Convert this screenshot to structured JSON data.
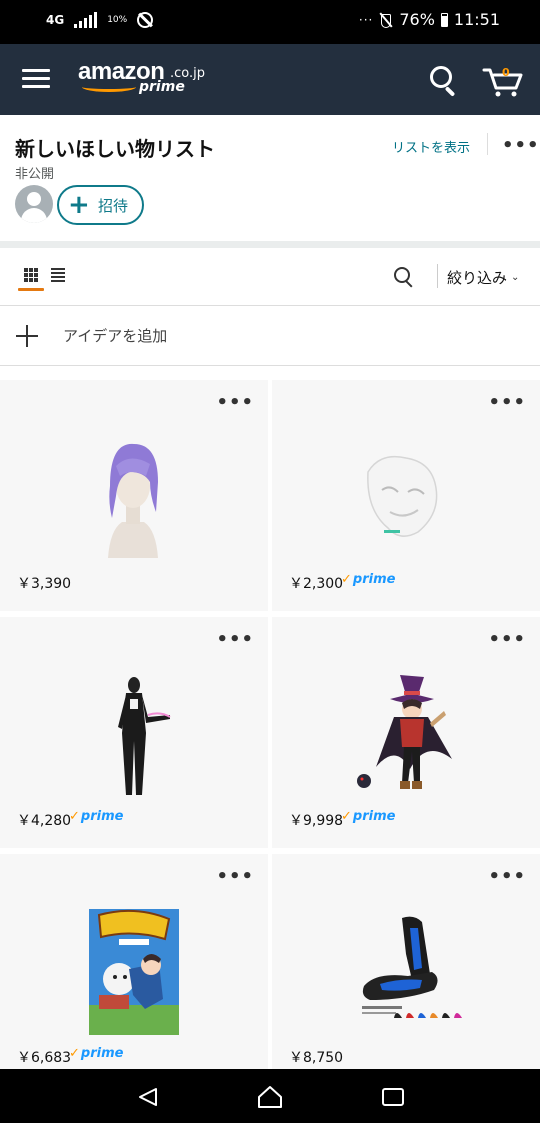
{
  "status_bar": {
    "network": "4G",
    "data_saver": "10%",
    "overflow": "···",
    "battery_pct": "76%",
    "time": "11:51",
    "icons": [
      "signal-icon",
      "rotate-lock-icon",
      "mute-icon",
      "battery-icon"
    ]
  },
  "header": {
    "logo_word": "amazon",
    "logo_tld": ".co.jp",
    "logo_prime": "prime",
    "cart_count": "0",
    "brand_color": "#232f3e",
    "accent_color": "#ff9900"
  },
  "list": {
    "title": "新しいほしい物リスト",
    "privacy": "非公開",
    "view_list_link": "リストを表示",
    "invite_label": "招待",
    "link_color": "#007185"
  },
  "toolbar": {
    "filter_label": "絞り込み"
  },
  "add_idea": {
    "label": "アイデアを追加"
  },
  "products": [
    {
      "price": "￥3,390",
      "prime": false,
      "image": "purple-wig"
    },
    {
      "price": "￥2,300",
      "prime": true,
      "image": "white-mask"
    },
    {
      "price": "￥4,280",
      "prime": true,
      "image": "black-bodysuit"
    },
    {
      "price": "￥9,998",
      "prime": true,
      "image": "witch-figure"
    },
    {
      "price": "￥6,683",
      "prime": true,
      "image": "dvd-box"
    },
    {
      "price": "￥8,750",
      "prime": false,
      "image": "gaming-floor-chair"
    }
  ],
  "prime_badge": "prime"
}
